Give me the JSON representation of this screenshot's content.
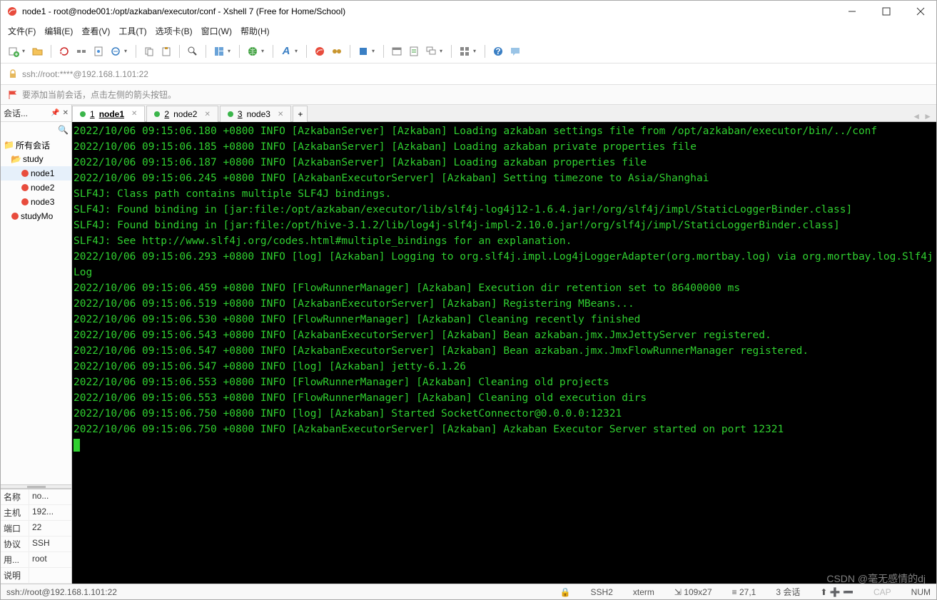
{
  "window": {
    "title": "node1 - root@node001:/opt/azkaban/executor/conf - Xshell 7 (Free for Home/School)"
  },
  "menu": {
    "file": "文件(F)",
    "edit": "编辑(E)",
    "view": "查看(V)",
    "tools": "工具(T)",
    "tabs": "选项卡(B)",
    "window": "窗口(W)",
    "help": "帮助(H)"
  },
  "address": {
    "url": "ssh://root:****@192.168.1.101:22"
  },
  "hint": {
    "text": "要添加当前会话，点击左侧的箭头按钮。"
  },
  "sidebar": {
    "title": "会话...",
    "tree": {
      "root": "所有会话",
      "folder": "study",
      "items": [
        "node1",
        "node2",
        "node3",
        "studyMo"
      ]
    },
    "props": {
      "name_k": "名称",
      "name_v": "no...",
      "host_k": "主机",
      "host_v": "192...",
      "port_k": "端口",
      "port_v": "22",
      "proto_k": "协议",
      "proto_v": "SSH",
      "user_k": "用...",
      "user_v": "root",
      "desc_k": "说明",
      "desc_v": ""
    }
  },
  "tabs": [
    {
      "num": "1",
      "label": "node1",
      "active": true,
      "underline": true
    },
    {
      "num": "2",
      "label": "node2",
      "active": false,
      "underline": false
    },
    {
      "num": "3",
      "label": "node3",
      "active": false,
      "underline": false
    }
  ],
  "terminal": {
    "lines": [
      "2022/10/06 09:15:06.180 +0800 INFO [AzkabanServer] [Azkaban] Loading azkaban settings file from /opt/azkaban/executor/bin/../conf",
      "2022/10/06 09:15:06.185 +0800 INFO [AzkabanServer] [Azkaban] Loading azkaban private properties file",
      "2022/10/06 09:15:06.187 +0800 INFO [AzkabanServer] [Azkaban] Loading azkaban properties file",
      "2022/10/06 09:15:06.245 +0800 INFO [AzkabanExecutorServer] [Azkaban] Setting timezone to Asia/Shanghai",
      "SLF4J: Class path contains multiple SLF4J bindings.",
      "SLF4J: Found binding in [jar:file:/opt/azkaban/executor/lib/slf4j-log4j12-1.6.4.jar!/org/slf4j/impl/StaticLoggerBinder.class]",
      "SLF4J: Found binding in [jar:file:/opt/hive-3.1.2/lib/log4j-slf4j-impl-2.10.0.jar!/org/slf4j/impl/StaticLoggerBinder.class]",
      "SLF4J: See http://www.slf4j.org/codes.html#multiple_bindings for an explanation.",
      "2022/10/06 09:15:06.293 +0800 INFO [log] [Azkaban] Logging to org.slf4j.impl.Log4jLoggerAdapter(org.mortbay.log) via org.mortbay.log.Slf4jLog",
      "2022/10/06 09:15:06.459 +0800 INFO [FlowRunnerManager] [Azkaban] Execution dir retention set to 86400000 ms",
      "2022/10/06 09:15:06.519 +0800 INFO [AzkabanExecutorServer] [Azkaban] Registering MBeans...",
      "2022/10/06 09:15:06.530 +0800 INFO [FlowRunnerManager] [Azkaban] Cleaning recently finished",
      "2022/10/06 09:15:06.543 +0800 INFO [AzkabanExecutorServer] [Azkaban] Bean azkaban.jmx.JmxJettyServer registered.",
      "2022/10/06 09:15:06.547 +0800 INFO [AzkabanExecutorServer] [Azkaban] Bean azkaban.jmx.JmxFlowRunnerManager registered.",
      "2022/10/06 09:15:06.547 +0800 INFO [log] [Azkaban] jetty-6.1.26",
      "2022/10/06 09:15:06.553 +0800 INFO [FlowRunnerManager] [Azkaban] Cleaning old projects",
      "2022/10/06 09:15:06.553 +0800 INFO [FlowRunnerManager] [Azkaban] Cleaning old execution dirs",
      "2022/10/06 09:15:06.750 +0800 INFO [log] [Azkaban] Started SocketConnector@0.0.0.0:12321",
      "2022/10/06 09:15:06.750 +0800 INFO [AzkabanExecutorServer] [Azkaban] Azkaban Executor Server started on port 12321"
    ]
  },
  "status": {
    "conn": "ssh://root@192.168.1.101:22",
    "ssh": "SSH2",
    "term": "xterm",
    "size": "109x27",
    "cursor": "27,1",
    "sess": "3 会话",
    "caps": "CAP",
    "num": "NUM"
  },
  "watermark": "CSDN @毫无感情的dj"
}
